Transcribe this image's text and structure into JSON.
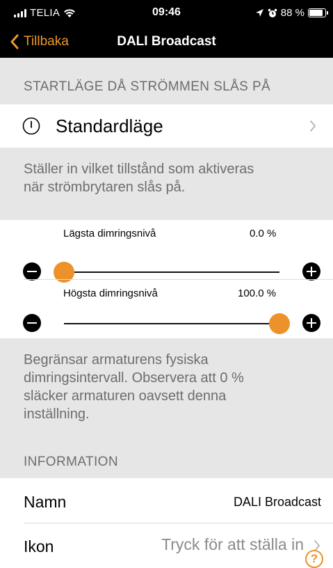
{
  "status_bar": {
    "carrier": "TELIA",
    "time": "09:46",
    "battery": "88 %"
  },
  "nav": {
    "back_label": "Tillbaka",
    "title": "DALI Broadcast"
  },
  "power_on": {
    "header": "STARTLÄGE DÅ STRÖMMEN SLÅS PÅ",
    "mode_label": "Standardläge",
    "description_lines": [
      "Ställer in vilket tillstånd som aktiveras",
      "när strömbrytaren slås på."
    ]
  },
  "dimming": {
    "min": {
      "label": "Lägsta dimringsnivå",
      "value": "0.0 %",
      "fraction": 0.0
    },
    "max": {
      "label": "Högsta dimringsnivå",
      "value": "100.0 %",
      "fraction": 1.0
    },
    "description_lines": [
      "Begränsar armaturens fysiska",
      "dimringsintervall. Observera att 0 %",
      "släcker armaturen oavsett denna",
      "inställning."
    ]
  },
  "information": {
    "header": "INFORMATION",
    "name_label": "Namn",
    "name_value": "DALI Broadcast",
    "icon_label": "Ikon",
    "icon_value": "Tryck för att ställa in",
    "help_glyph": "?"
  },
  "colors": {
    "accent": "#ec922a",
    "background": "#e6e6e6",
    "secondary_text": "#6d6d6d"
  }
}
